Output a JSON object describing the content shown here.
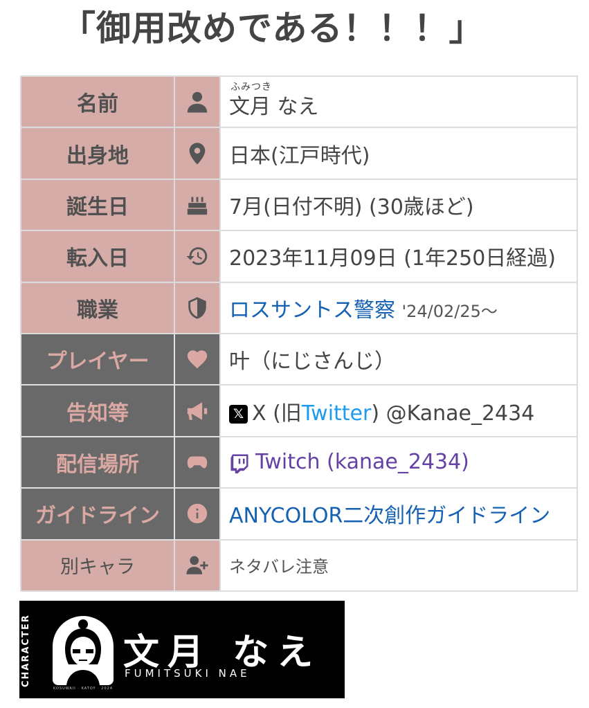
{
  "title": "「御用改めである！！！」",
  "rows": [
    {
      "label": "名前",
      "icon": "person-icon"
    },
    {
      "label": "出身地",
      "icon": "location-pin-icon"
    },
    {
      "label": "誕生日",
      "icon": "birthday-cake-icon"
    },
    {
      "label": "転入日",
      "icon": "history-icon"
    },
    {
      "label": "職業",
      "icon": "shield-icon"
    },
    {
      "label": "プレイヤー",
      "icon": "heart-icon"
    },
    {
      "label": "告知等",
      "icon": "megaphone-icon"
    },
    {
      "label": "配信場所",
      "icon": "gamepad-icon"
    },
    {
      "label": "ガイドライン",
      "icon": "info-icon"
    },
    {
      "label": "別キャラ",
      "icon": "add-user-icon"
    }
  ],
  "name": {
    "ruby": "ふみつき",
    "value": "文月 なえ"
  },
  "birthplace": "日本(江戸時代)",
  "birthday": "7月(日付不明) (30歳ほど)",
  "join_date": "2023年11月09日 (1年250日経過)",
  "occupation": {
    "link": "ロスサントス警察",
    "since": "'24/02/25～"
  },
  "player": "叶（にじさんじ）",
  "announcement": {
    "x_logo": "𝕏",
    "prefix": "X (旧",
    "twitter": "Twitter",
    "suffix": ") @Kanae_2434"
  },
  "stream": "Twitch (kanae_2434)",
  "guideline": "ANYCOLOR二次創作ガイドライン",
  "alt_character": "ネタバレ注意",
  "banner": {
    "vertical": "CHARACTER",
    "name": "文月 なえ",
    "roman": "FUMITSUKI NAE",
    "caption": "KOSUWAII · KATOY · 2024"
  },
  "colors": {
    "label_pink": "#d5aca7",
    "label_dark": "#696969",
    "link_blue": "#1460b3",
    "twitch_purple": "#6441a5",
    "twitter_blue": "#1d9bf0"
  }
}
